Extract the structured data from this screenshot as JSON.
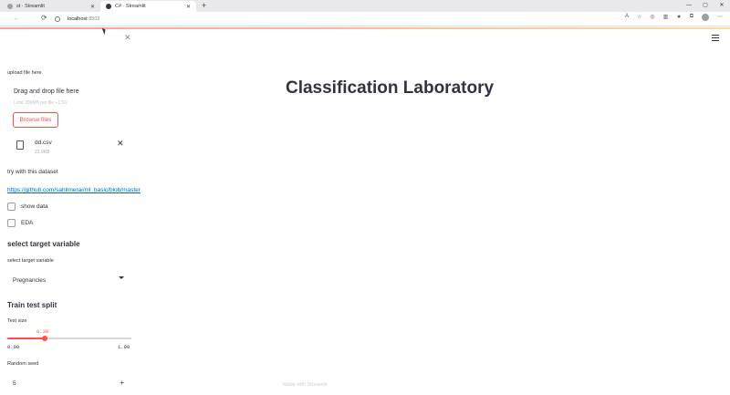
{
  "browser": {
    "tabs": [
      {
        "label": "st · Streamlit",
        "active": false
      },
      {
        "label": "C# · Streamlit",
        "active": true
      }
    ],
    "new_tab": "+",
    "window_controls": [
      "—",
      "▢",
      "✕"
    ],
    "nav": {
      "back": "←",
      "refresh": "⟳"
    },
    "address": {
      "host": "localhost",
      "port": ":8502"
    }
  },
  "sidebar": {
    "close": "✕",
    "upload_label": "upload file here",
    "dropzone_title": "Drag and drop file here",
    "dropzone_limit": "Limit 200MB per file • CSV",
    "browse_button": "Browse files",
    "file": {
      "name": "dd.csv",
      "size": "23.9KB",
      "remove": "✕"
    },
    "try_text": "try with this dataset",
    "dataset_link": "https://github.com/sahilmerai/ml_basic/blob/master/diabetes.csv",
    "show_data": "show data",
    "eda": "EDA",
    "target_heading": "select target variable",
    "target_label": "select target variable",
    "target_value": "Pregnancies",
    "split_heading": "Train test split",
    "test_size_label": "Test size",
    "test_size": {
      "value_text": "0.30",
      "min": "0.00",
      "max": "1.00",
      "fraction": 0.3
    },
    "seed_label": "Random seed",
    "seed_value": "5",
    "seed_plus": "+"
  },
  "main": {
    "title": "Classification Laboratory",
    "footer": "Made with Streamlit"
  },
  "colors": {
    "accent": "#ff4b4b",
    "link": "#0068c9",
    "text": "#31333f"
  }
}
